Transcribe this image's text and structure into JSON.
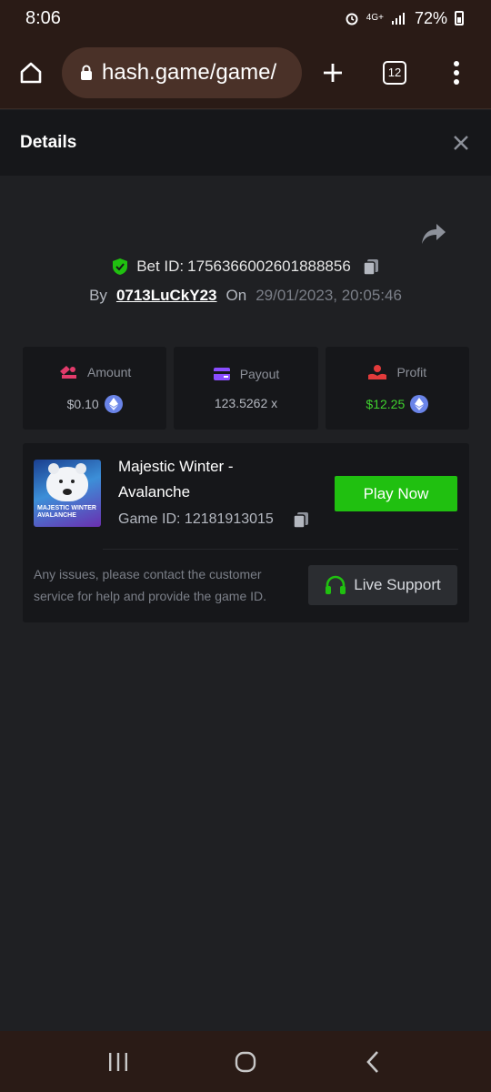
{
  "status": {
    "time": "8:06",
    "network": "4G+",
    "battery": "72%"
  },
  "browser": {
    "url": "hash.game/game/",
    "tab_count": "12"
  },
  "header": {
    "title": "Details"
  },
  "bet": {
    "bet_id_label": "Bet ID:",
    "bet_id": "1756366002601888856",
    "by_label": "By",
    "username": "0713LuCkY23",
    "on_label": "On",
    "datetime": "29/01/2023, 20:05:46"
  },
  "stats": {
    "amount": {
      "label": "Amount",
      "value": "$0.10"
    },
    "payout": {
      "label": "Payout",
      "value": "123.5262 x"
    },
    "profit": {
      "label": "Profit",
      "value": "$12.25"
    }
  },
  "game": {
    "name": "Majestic Winter - Avalanche",
    "thumb_text": "MAJESTIC WINTER AVALANCHE",
    "id_label": "Game ID:",
    "id": "12181913015",
    "play_label": "Play Now",
    "issues_text": "Any issues, please contact the customer service for help and provide the game ID.",
    "support_label": "Live Support"
  },
  "colors": {
    "accent_green": "#20c010",
    "profit_green": "#3fd12e",
    "eth_blue": "#6a84e8"
  },
  "icons": [
    "home-icon",
    "lock-icon",
    "plus-icon",
    "tabs-icon",
    "more-icon",
    "close-icon",
    "share-icon",
    "shield-check-icon",
    "copy-icon",
    "amount-icon",
    "payout-icon",
    "profit-icon",
    "eth-icon",
    "headset-icon",
    "recents-icon",
    "home-circle-icon",
    "back-icon"
  ]
}
